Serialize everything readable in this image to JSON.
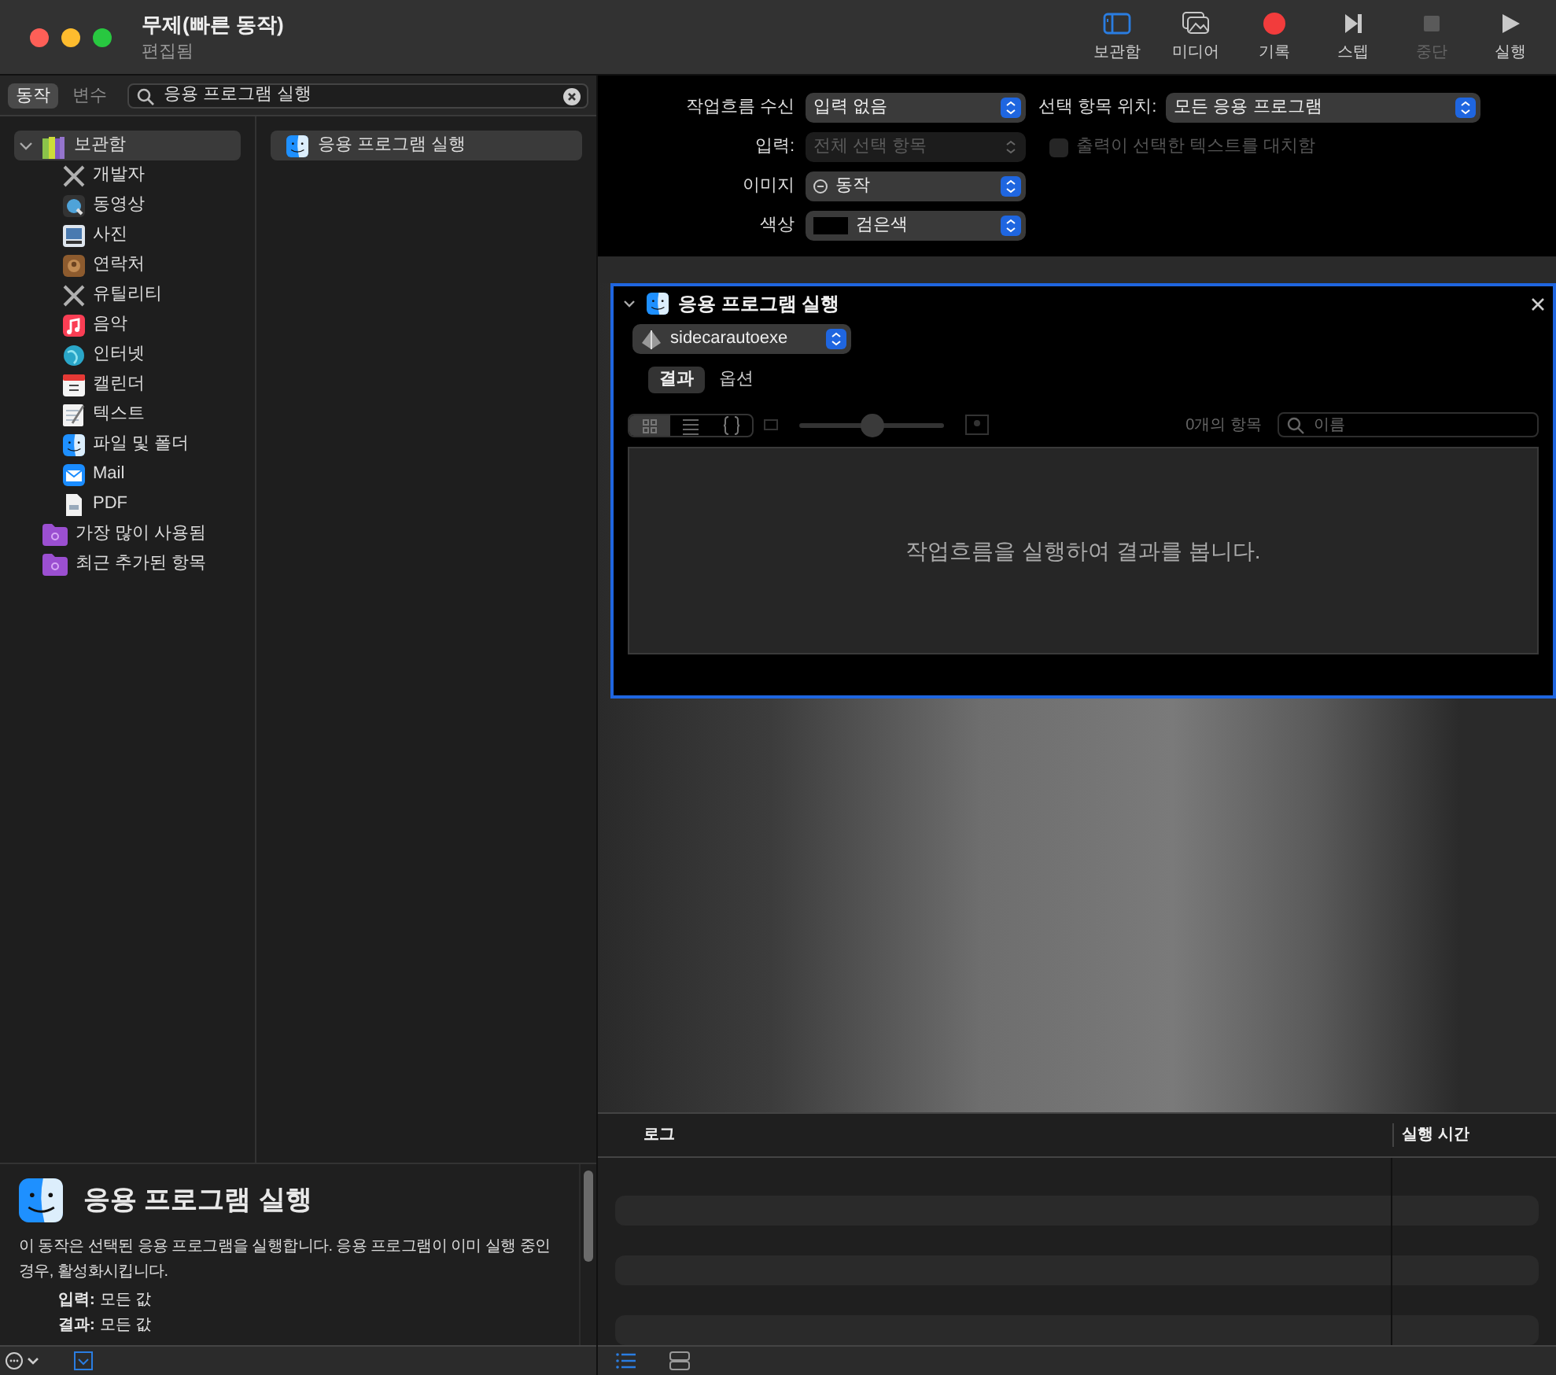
{
  "window": {
    "title": "무제(빠른 동작)",
    "subtitle": "편집됨"
  },
  "toolbar": [
    {
      "kind": "library",
      "label": "보관함",
      "disabled": false,
      "selected": true
    },
    {
      "kind": "media",
      "label": "미디어",
      "disabled": false,
      "selected": false
    },
    {
      "kind": "record",
      "label": "기록",
      "disabled": false,
      "selected": false
    },
    {
      "kind": "step",
      "label": "스텝",
      "disabled": false,
      "selected": false
    },
    {
      "kind": "stop",
      "label": "중단",
      "disabled": true,
      "selected": false
    },
    {
      "kind": "run",
      "label": "실행",
      "disabled": false,
      "selected": false
    }
  ],
  "left_tabs": [
    {
      "label": "동작",
      "selected": true
    },
    {
      "label": "변수",
      "selected": false
    }
  ],
  "search": {
    "value": "응용 프로그램 실행"
  },
  "library": [
    {
      "kind": "library",
      "label": "보관함",
      "expanded": true,
      "selected": true,
      "children": [
        {
          "kind": "tools",
          "label": "개발자"
        },
        {
          "kind": "movie",
          "label": "동영상"
        },
        {
          "kind": "photo",
          "label": "사진"
        },
        {
          "kind": "contacts",
          "label": "연락처"
        },
        {
          "kind": "tools",
          "label": "유틸리티"
        },
        {
          "kind": "music",
          "label": "음악"
        },
        {
          "kind": "globe",
          "label": "인터넷"
        },
        {
          "kind": "calendar",
          "label": "캘린더"
        },
        {
          "kind": "text",
          "label": "텍스트"
        },
        {
          "kind": "finder",
          "label": "파일 및 폴더"
        },
        {
          "kind": "mail",
          "label": "Mail"
        },
        {
          "kind": "pdf",
          "label": "PDF"
        }
      ]
    },
    {
      "kind": "smartfolder",
      "label": "가장 많이 사용됨",
      "selected": false
    },
    {
      "kind": "smartfolder",
      "label": "최근 추가된 항목",
      "selected": false
    }
  ],
  "actions": [
    {
      "label": "응용 프로그램 실행",
      "selected": true
    }
  ],
  "description": {
    "title": "응용 프로그램 실행",
    "text": "이 동작은 선택된 응용 프로그램을 실행합니다. 응용 프로그램이 이미 실행 중인 경우, 활성화시킵니다.",
    "input_label": "입력:",
    "input_value": "모든 값",
    "result_label": "결과:",
    "result_value": "모든 값"
  },
  "workflow_settings": {
    "receives": {
      "label": "작업흐름 수신",
      "value": "입력 없음"
    },
    "location": {
      "label": "선택 항목 위치:",
      "value": "모든 응용 프로그램"
    },
    "input": {
      "label": "입력:",
      "value": "전체 선택 항목",
      "disabled": true
    },
    "replace": {
      "label": "출력이 선택한 텍스트를 대치함",
      "checked": false,
      "disabled": true
    },
    "image": {
      "label": "이미지",
      "value": "동작"
    },
    "color": {
      "label": "색상",
      "value": "검은색"
    }
  },
  "action_card": {
    "title": "응용 프로그램 실행",
    "expanded": true,
    "app": "sidecarautoexe",
    "tabs": [
      {
        "label": "결과",
        "selected": true
      },
      {
        "label": "옵션",
        "selected": false
      }
    ],
    "view_modes": [
      {
        "kind": "grid",
        "selected": true
      },
      {
        "kind": "list",
        "selected": false
      },
      {
        "kind": "code",
        "selected": false
      }
    ],
    "zoom": {
      "level": 0.5
    },
    "item_count": "0개의 항목",
    "search_placeholder": "이름",
    "message": "작업흐름을 실행하여 결과를 봅니다."
  },
  "log": {
    "columns": [
      "로그",
      "실행 시간"
    ]
  },
  "log_views": [
    {
      "kind": "list",
      "selected": true
    },
    {
      "kind": "split",
      "selected": false
    }
  ]
}
